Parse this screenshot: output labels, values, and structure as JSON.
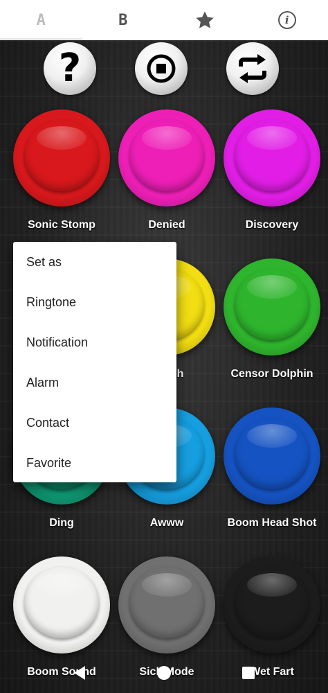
{
  "tabs": [
    {
      "label": "A",
      "active": true
    },
    {
      "label": "B",
      "active": false
    },
    {
      "icon": "star-icon",
      "active": false
    },
    {
      "icon": "info-icon",
      "label": "i",
      "active": false
    }
  ],
  "controls": [
    {
      "icon": "help-icon",
      "glyph": "?"
    },
    {
      "icon": "stop-icon"
    },
    {
      "icon": "repeat-icon"
    }
  ],
  "sounds": [
    {
      "label": "Sonic Stomp",
      "color": "#d8181c"
    },
    {
      "label": "Denied",
      "color": "#ee1fb7"
    },
    {
      "label": "Discovery",
      "color": "#e21ee6"
    },
    {
      "label": "Punch",
      "color": "#f2de12"
    },
    {
      "label": "Censor Dolphin",
      "color": "#2fb52d"
    },
    {
      "label": "Ding",
      "color": "#0f9a74"
    },
    {
      "label": "Awww",
      "color": "#169fe0"
    },
    {
      "label": "Boom Head Shot",
      "color": "#1553c2"
    },
    {
      "label": "Boom Sound",
      "color": "#f1f1ef"
    },
    {
      "label": "Sick Mode",
      "color": "#707070"
    },
    {
      "label": "Wet Fart",
      "color": "#1c1c1c"
    }
  ],
  "menu": {
    "items": [
      "Set as",
      "Ringtone",
      "Notification",
      "Alarm",
      "Contact",
      "Favorite"
    ]
  }
}
